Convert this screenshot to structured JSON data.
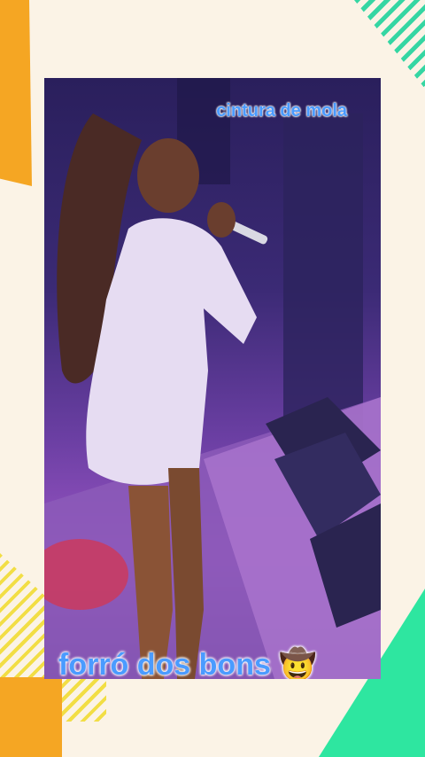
{
  "overlay": {
    "top_caption": "cintura de mola",
    "bottom_caption": "forró dos bons 🤠"
  },
  "colors": {
    "caption_text": "#4a9bff",
    "caption_outline": "#ffffff",
    "background": "#fbf3e6",
    "accent_orange": "#f5a623",
    "accent_teal": "#35d6a3",
    "accent_yellow": "#f2de45",
    "accent_green": "#2ee6a0"
  }
}
